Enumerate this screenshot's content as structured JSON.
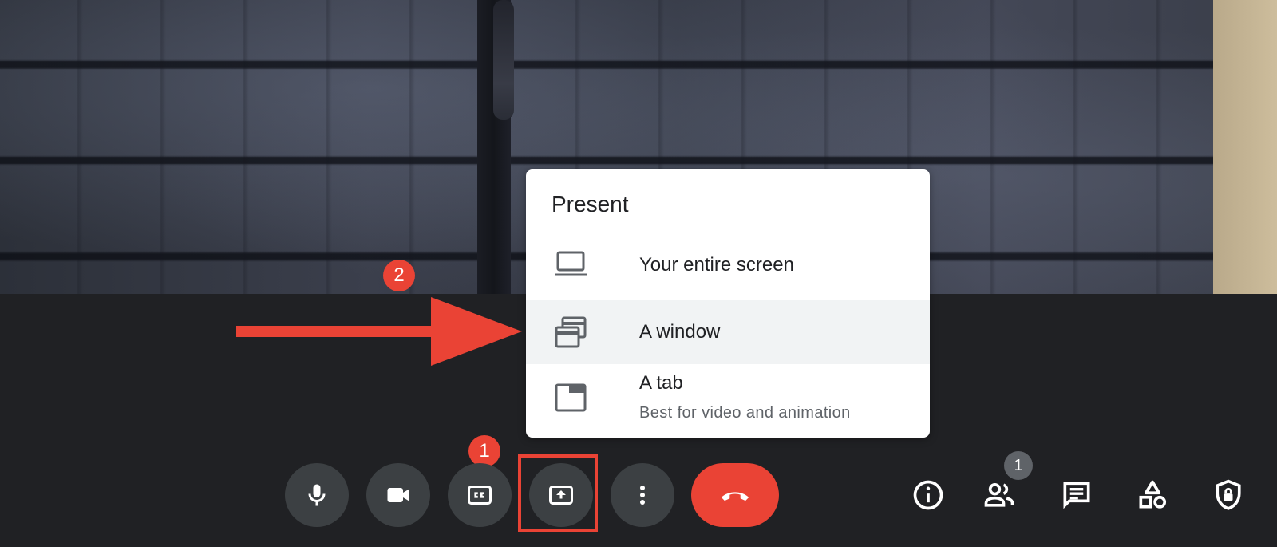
{
  "present_menu": {
    "title": "Present",
    "items": [
      {
        "label": "Your entire screen",
        "icon": "laptop-icon"
      },
      {
        "label": "A window",
        "icon": "window-icon",
        "highlighted": true
      },
      {
        "label": "A tab",
        "sublabel": "Best for video and animation",
        "icon": "browser-tab-icon"
      }
    ]
  },
  "annotations": {
    "step_1": "1",
    "step_2": "2",
    "accent_color": "#ea4335"
  },
  "controls": [
    {
      "name": "microphone",
      "icon": "microphone-icon"
    },
    {
      "name": "camera",
      "icon": "camera-icon"
    },
    {
      "name": "captions",
      "icon": "closed-captions-icon"
    },
    {
      "name": "present-now",
      "icon": "present-screen-icon"
    },
    {
      "name": "more-options",
      "icon": "more-vert-icon"
    },
    {
      "name": "leave-call",
      "icon": "hang-up-icon",
      "color": "#ea4335"
    }
  ],
  "side_controls": {
    "people_count": "1",
    "items": [
      {
        "name": "meeting-details",
        "icon": "info-icon"
      },
      {
        "name": "people",
        "icon": "people-icon"
      },
      {
        "name": "chat",
        "icon": "chat-icon"
      },
      {
        "name": "activities",
        "icon": "activities-icon"
      },
      {
        "name": "host-controls",
        "icon": "shield-lock-icon"
      }
    ]
  },
  "colors": {
    "bar_background": "#202124",
    "button_background": "#3c4043",
    "menu_hover": "#f1f3f4"
  }
}
